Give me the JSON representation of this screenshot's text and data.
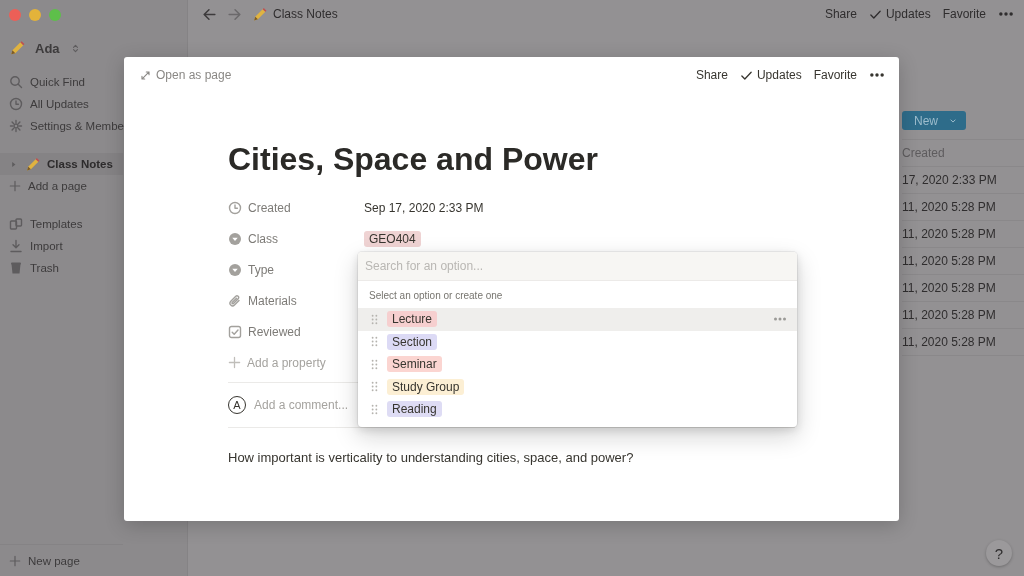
{
  "sidebar": {
    "workspace": "Ada",
    "items": [
      {
        "kind": "search",
        "label": "Quick Find"
      },
      {
        "kind": "clock",
        "label": "All Updates"
      },
      {
        "kind": "gear",
        "label": "Settings & Membe"
      }
    ],
    "pages": [
      {
        "label": "Class Notes",
        "selected": true,
        "expanded": false
      }
    ],
    "add_page": "Add a page",
    "tools": [
      {
        "kind": "templates",
        "label": "Templates"
      },
      {
        "kind": "import",
        "label": "Import"
      },
      {
        "kind": "trash",
        "label": "Trash"
      }
    ],
    "new_page": "New page"
  },
  "topbar": {
    "breadcrumb": "Class Notes",
    "actions": [
      {
        "label": "Share"
      },
      {
        "label": "Updates",
        "kind": "check"
      },
      {
        "label": "Favorite"
      }
    ]
  },
  "table": {
    "new_button": "New",
    "column": "Created",
    "rows": [
      "17, 2020 2:33 PM",
      "11, 2020 5:28 PM",
      "11, 2020 5:28 PM",
      "11, 2020 5:28 PM",
      "11, 2020 5:28 PM",
      "11, 2020 5:28 PM",
      "11, 2020 5:28 PM"
    ]
  },
  "modal": {
    "open_as_page": "Open as page",
    "actions": [
      {
        "label": "Share"
      },
      {
        "label": "Updates",
        "kind": "check"
      },
      {
        "label": "Favorite"
      }
    ],
    "title": "Cities, Space and Power",
    "properties": [
      {
        "kind": "clock",
        "label": "Created",
        "value": "Sep 17, 2020 2:33 PM"
      },
      {
        "kind": "select",
        "label": "Class",
        "tags": [
          {
            "label": "GEO404",
            "color": "#efd3d3"
          }
        ]
      },
      {
        "kind": "select",
        "label": "Type"
      },
      {
        "kind": "files",
        "label": "Materials"
      },
      {
        "kind": "checkbox",
        "label": "Reviewed"
      }
    ],
    "add_property": "Add a property",
    "comment": {
      "avatar": "A",
      "placeholder": "Add a comment..."
    },
    "body": "How important is verticality to understanding cities, space, and power?"
  },
  "menu": {
    "placeholder": "Search for an option...",
    "hint": "Select an option or create one",
    "options": [
      {
        "label": "Lecture",
        "color": "#f6cfcf",
        "selected": true
      },
      {
        "label": "Section",
        "color": "#dcdaf5",
        "selected": false
      },
      {
        "label": "Seminar",
        "color": "#fbd5d1",
        "selected": false
      },
      {
        "label": "Study Group",
        "color": "#fcefd4",
        "selected": false
      },
      {
        "label": "Reading",
        "color": "#dedcf4",
        "selected": false
      }
    ]
  },
  "help_button": "?"
}
